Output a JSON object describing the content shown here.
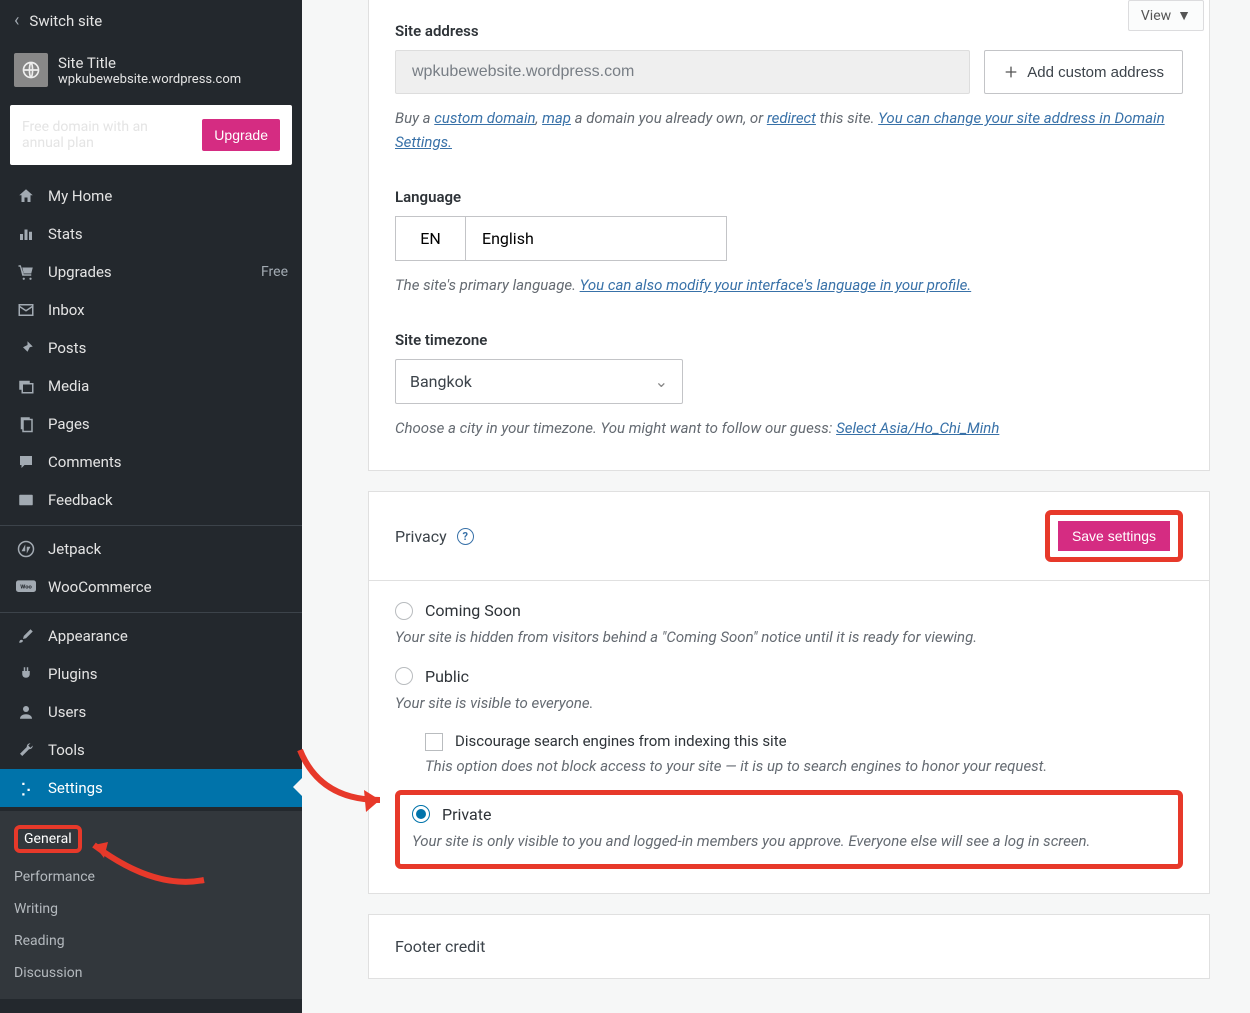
{
  "sidebar": {
    "switch_site": "Switch site",
    "site_title": "Site Title",
    "site_url": "wpkubewebsite.wordpress.com",
    "promo_text": "Free domain with an annual plan",
    "upgrade": "Upgrade",
    "items": [
      {
        "label": "My Home"
      },
      {
        "label": "Stats"
      },
      {
        "label": "Upgrades",
        "badge": "Free"
      },
      {
        "label": "Inbox"
      },
      {
        "label": "Posts"
      },
      {
        "label": "Media"
      },
      {
        "label": "Pages"
      },
      {
        "label": "Comments"
      },
      {
        "label": "Feedback"
      },
      {
        "label": "Jetpack"
      },
      {
        "label": "WooCommerce"
      },
      {
        "label": "Appearance"
      },
      {
        "label": "Plugins"
      },
      {
        "label": "Users"
      },
      {
        "label": "Tools"
      },
      {
        "label": "Settings"
      }
    ],
    "submenu": [
      "General",
      "Performance",
      "Writing",
      "Reading",
      "Discussion"
    ]
  },
  "view_btn": "View",
  "site_address": {
    "label": "Site address",
    "value": "wpkubewebsite.wordpress.com",
    "add_custom": "Add custom address",
    "help_pre": "Buy a ",
    "link1": "custom domain",
    "mid1": ", ",
    "link2": "map",
    "mid2": " a domain you already own, or ",
    "link3": "redirect",
    "mid3": " this site. ",
    "link4": "You can change your site address in Domain Settings."
  },
  "language": {
    "label": "Language",
    "code": "EN",
    "name": "English",
    "help_pre": "The site's primary language. ",
    "link": "You can also modify your interface's language in your profile."
  },
  "timezone": {
    "label": "Site timezone",
    "value": "Bangkok",
    "help_pre": "Choose a city in your timezone. You might want to follow our guess: ",
    "link": "Select Asia/Ho_Chi_Minh"
  },
  "privacy": {
    "title": "Privacy",
    "save": "Save settings",
    "options": [
      {
        "label": "Coming Soon",
        "desc": "Your site is hidden from visitors behind a \"Coming Soon\" notice until it is ready for viewing."
      },
      {
        "label": "Public",
        "desc": "Your site is visible to everyone."
      },
      {
        "label": "Private",
        "desc": "Your site is only visible to you and logged-in members you approve. Everyone else will see a log in screen."
      }
    ],
    "discourage": "Discourage search engines from indexing this site",
    "discourage_desc": "This option does not block access to your site — it is up to search engines to honor your request."
  },
  "footer": {
    "label": "Footer credit"
  }
}
